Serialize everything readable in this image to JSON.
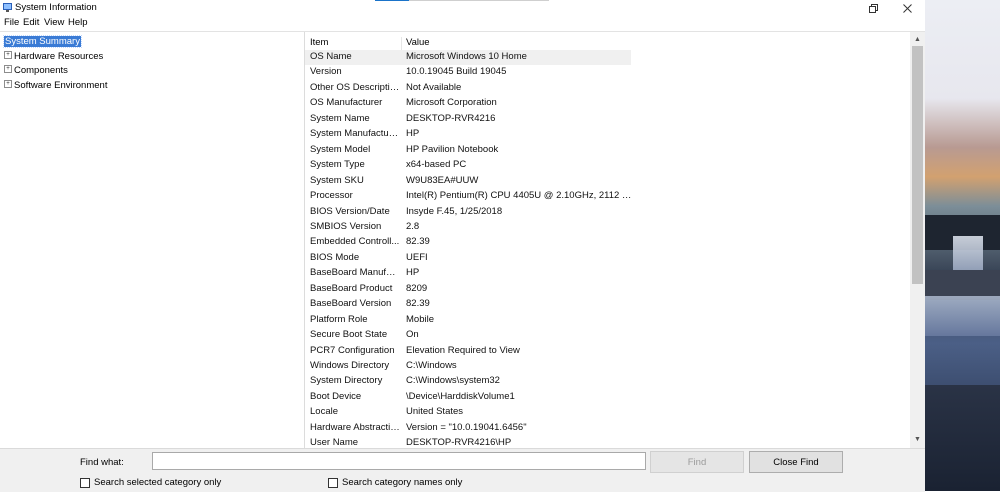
{
  "window": {
    "title": "System Information",
    "restore_icon": "restore-icon",
    "close_icon": "close-icon"
  },
  "menu": [
    "File",
    "Edit",
    "View",
    "Help"
  ],
  "tree": [
    {
      "label": "System Summary",
      "selected": true,
      "expandable": false
    },
    {
      "label": "Hardware Resources",
      "expandable": true
    },
    {
      "label": "Components",
      "expandable": true
    },
    {
      "label": "Software Environment",
      "expandable": true
    }
  ],
  "list": {
    "headers": {
      "item": "Item",
      "value": "Value"
    },
    "rows": [
      {
        "item": "OS Name",
        "value": "Microsoft Windows 10 Home"
      },
      {
        "item": "Version",
        "value": "10.0.19045 Build 19045"
      },
      {
        "item": "Other OS Description",
        "value": "Not Available"
      },
      {
        "item": "OS Manufacturer",
        "value": "Microsoft Corporation"
      },
      {
        "item": "System Name",
        "value": "DESKTOP-RVR4216"
      },
      {
        "item": "System Manufacturer",
        "value": "HP"
      },
      {
        "item": "System Model",
        "value": "HP Pavilion Notebook"
      },
      {
        "item": "System Type",
        "value": "x64-based PC"
      },
      {
        "item": "System SKU",
        "value": "W9U83EA#UUW"
      },
      {
        "item": "Processor",
        "value": "Intel(R) Pentium(R) CPU 4405U @ 2.10GHz, 2112 M..."
      },
      {
        "item": "BIOS Version/Date",
        "value": "Insyde F.45, 1/25/2018"
      },
      {
        "item": "SMBIOS Version",
        "value": "2.8"
      },
      {
        "item": "Embedded Controll...",
        "value": "82.39"
      },
      {
        "item": "BIOS Mode",
        "value": "UEFI"
      },
      {
        "item": "BaseBoard Manufact...",
        "value": "HP"
      },
      {
        "item": "BaseBoard Product",
        "value": "8209"
      },
      {
        "item": "BaseBoard Version",
        "value": "82.39"
      },
      {
        "item": "Platform Role",
        "value": "Mobile"
      },
      {
        "item": "Secure Boot State",
        "value": "On"
      },
      {
        "item": "PCR7 Configuration",
        "value": "Elevation Required to View"
      },
      {
        "item": "Windows Directory",
        "value": "C:\\Windows"
      },
      {
        "item": "System Directory",
        "value": "C:\\Windows\\system32"
      },
      {
        "item": "Boot Device",
        "value": "\\Device\\HarddiskVolume1"
      },
      {
        "item": "Locale",
        "value": "United States"
      },
      {
        "item": "Hardware Abstractio...",
        "value": "Version = \"10.0.19041.6456\""
      },
      {
        "item": "User Name",
        "value": "DESKTOP-RVR4216\\HP"
      }
    ]
  },
  "find": {
    "label": "Find what:",
    "value": "",
    "find_button": "Find",
    "close_find_button": "Close Find",
    "search_selected_label": "Search selected category only",
    "search_names_label": "Search category names only"
  }
}
